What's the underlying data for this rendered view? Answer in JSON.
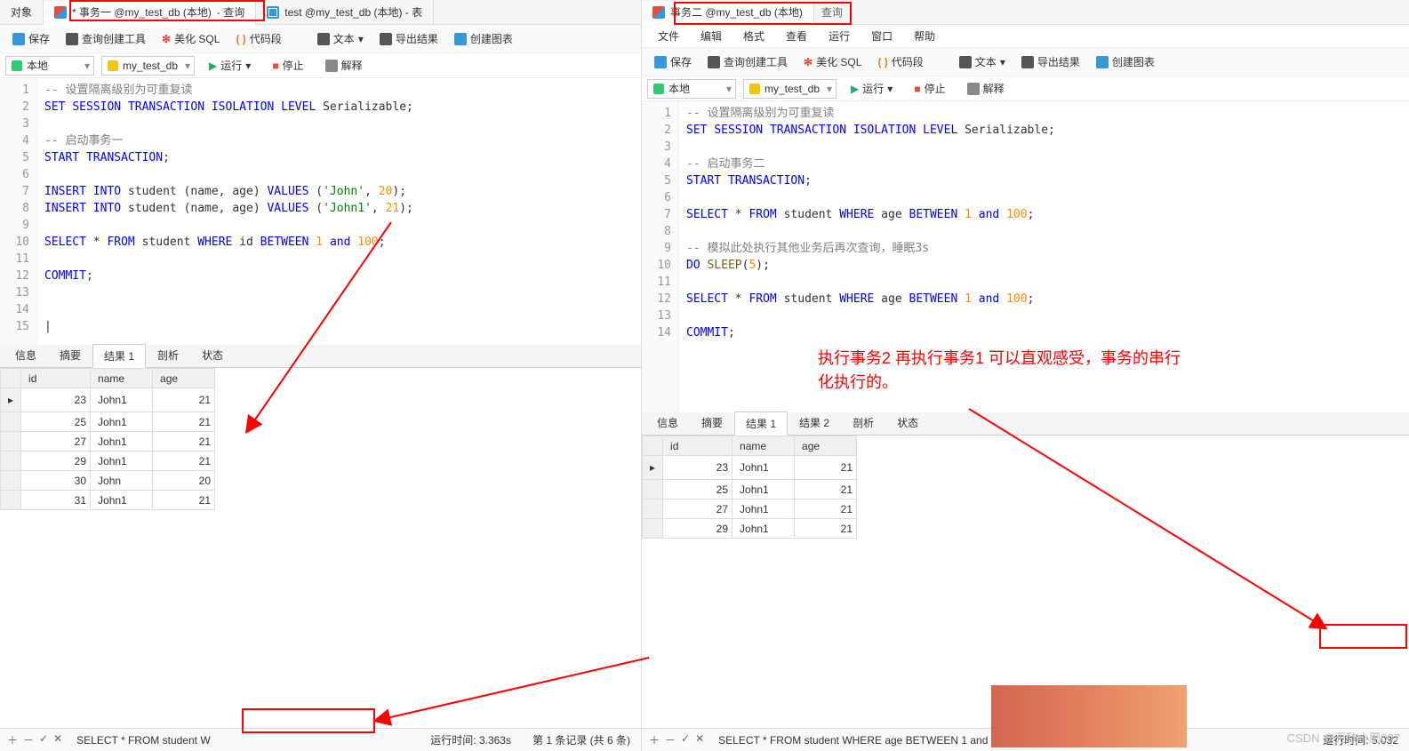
{
  "left": {
    "tabs": {
      "obj": "对象",
      "t1": "* 事务一 @my_test_db (本地)",
      "t1suf": "- 查询",
      "t2": "test @my_test_db (本地) - 表"
    },
    "toolbar": {
      "save": "保存",
      "tool": "查询创建工具",
      "beautify": "美化 SQL",
      "code": "代码段",
      "text": "文本",
      "export": "导出结果",
      "chart": "创建图表"
    },
    "row2": {
      "conn": "本地",
      "db": "my_test_db",
      "run": "运行",
      "stop": "停止",
      "explain": "解释"
    },
    "lines": [
      "1",
      "2",
      "3",
      "4",
      "5",
      "6",
      "7",
      "8",
      "9",
      "10",
      "11",
      "12",
      "13",
      "14",
      "15"
    ],
    "restabs": {
      "info": "信息",
      "summary": "摘要",
      "res1": "结果 1",
      "profile": "剖析",
      "status": "状态"
    },
    "cols": {
      "id": "id",
      "name": "name",
      "age": "age"
    },
    "rows": [
      {
        "id": "23",
        "name": "John1",
        "age": "21"
      },
      {
        "id": "25",
        "name": "John1",
        "age": "21"
      },
      {
        "id": "27",
        "name": "John1",
        "age": "21"
      },
      {
        "id": "29",
        "name": "John1",
        "age": "21"
      },
      {
        "id": "30",
        "name": "John",
        "age": "20"
      },
      {
        "id": "31",
        "name": "John1",
        "age": "21"
      }
    ],
    "ctrl": {
      "add": "＋",
      "sub": "－",
      "ok": "✓",
      "x": "✕"
    },
    "status": {
      "q": "SELECT * FROM student W",
      "time": "运行时间: 3.363s",
      "rec": "第 1 条记录  (共 6 条)"
    }
  },
  "right": {
    "tabs": {
      "t1": "事务二 @my_test_db (本地)",
      "t1suf": "查询"
    },
    "menu": {
      "file": "文件",
      "edit": "编辑",
      "format": "格式",
      "view": "查看",
      "run": "运行",
      "window": "窗口",
      "help": "帮助"
    },
    "toolbar": {
      "save": "保存",
      "tool": "查询创建工具",
      "beautify": "美化 SQL",
      "code": "代码段",
      "text": "文本",
      "export": "导出结果",
      "chart": "创建图表"
    },
    "row2": {
      "conn": "本地",
      "db": "my_test_db",
      "run": "运行",
      "stop": "停止",
      "explain": "解释"
    },
    "lines": [
      "1",
      "2",
      "3",
      "4",
      "5",
      "6",
      "7",
      "8",
      "9",
      "10",
      "11",
      "12",
      "13",
      "14"
    ],
    "restabs": {
      "info": "信息",
      "summary": "摘要",
      "res1": "结果 1",
      "res2": "结果 2",
      "profile": "剖析",
      "status": "状态"
    },
    "cols": {
      "id": "id",
      "name": "name",
      "age": "age"
    },
    "rows": [
      {
        "id": "23",
        "name": "John1",
        "age": "21"
      },
      {
        "id": "25",
        "name": "John1",
        "age": "21"
      },
      {
        "id": "27",
        "name": "John1",
        "age": "21"
      },
      {
        "id": "29",
        "name": "John1",
        "age": "21"
      }
    ],
    "ctrl": {
      "add": "＋",
      "sub": "－",
      "ok": "✓",
      "x": "✕"
    },
    "status": {
      "q": "SELECT * FROM student WHERE age BETWEEN 1 and 100",
      "time": "运行时间: 5.032"
    }
  },
  "annot": "执行事务2 再执行事务1 可以直观感受，事务的串行\n化执行的。",
  "watermark": "CSDN @无敌小肥007"
}
